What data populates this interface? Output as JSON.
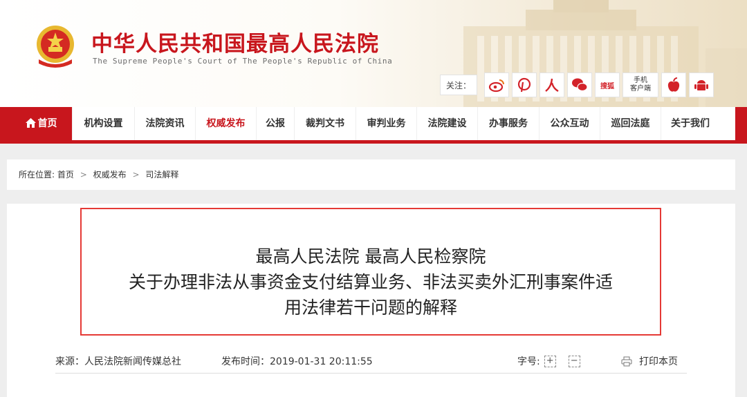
{
  "header": {
    "site_title": "中华人民共和国最高人民法院",
    "site_subtitle": "The Supreme People's Court of The People's Republic of China",
    "follow_label": "关注：",
    "social": [
      {
        "name": "weibo-icon"
      },
      {
        "name": "pinterest-icon"
      },
      {
        "name": "renren-icon"
      },
      {
        "name": "wechat-icon"
      },
      {
        "name": "sohu-icon",
        "text": "搜狐"
      },
      {
        "name": "mobile-client",
        "text1": "手机",
        "text2": "客户端"
      },
      {
        "name": "apple-icon"
      },
      {
        "name": "android-icon"
      }
    ]
  },
  "nav": {
    "items": [
      "首页",
      "机构设置",
      "法院资讯",
      "权威发布",
      "公报",
      "裁判文书",
      "审判业务",
      "法院建设",
      "办事服务",
      "公众互动",
      "巡回法庭",
      "关于我们"
    ],
    "active_index": 3
  },
  "breadcrumb": {
    "label": "所在位置:",
    "items": [
      "首页",
      "权威发布",
      "司法解释"
    ],
    "separator": ">"
  },
  "article": {
    "title_lines": [
      "最高人民法院 最高人民检察院",
      "关于办理非法从事资金支付结算业务、非法买卖外汇刑事案件适",
      "用法律若干问题的解释"
    ],
    "source": "来源：人民法院新闻传媒总社",
    "publish_time": "发布时间：2019-01-31 20:11:55",
    "font_size_label": "字号:",
    "font_increase": "+",
    "font_decrease": "−",
    "print_label": "打印本页"
  },
  "colors": {
    "brand_red": "#c8161d",
    "title_border": "#e53935"
  }
}
